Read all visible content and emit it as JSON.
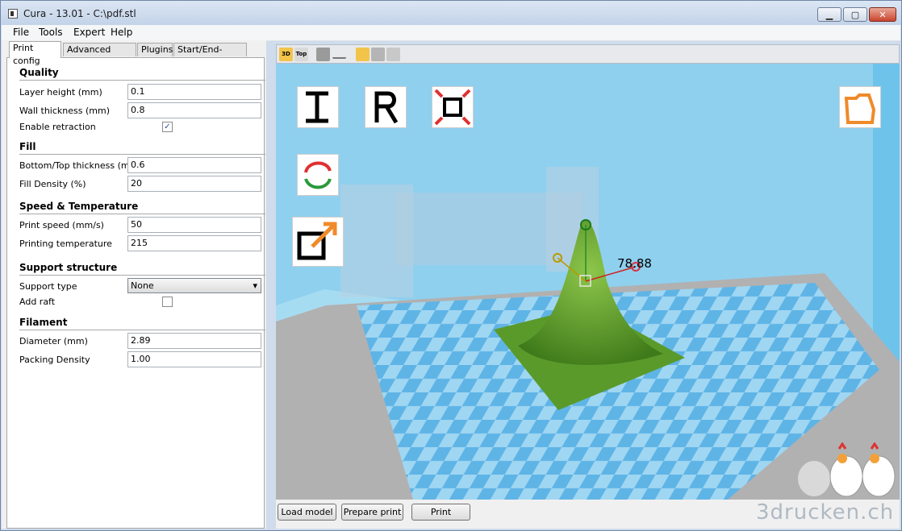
{
  "window": {
    "title": "Cura - 13.01 - C:\\pdf.stl",
    "controls": {
      "minimize": "▁",
      "maximize": "▢",
      "close": "✕"
    }
  },
  "menu": [
    "File",
    "Tools",
    "Expert",
    "Help"
  ],
  "tabs": [
    "Print config",
    "Advanced config",
    "Plugins",
    "Start/End-GCode"
  ],
  "print_config": {
    "quality": {
      "heading": "Quality",
      "layer_height_label": "Layer height (mm)",
      "layer_height": "0.1",
      "wall_thickness_label": "Wall thickness (mm)",
      "wall_thickness": "0.8",
      "enable_retraction_label": "Enable retraction",
      "enable_retraction": true
    },
    "fill": {
      "heading": "Fill",
      "bottom_top_label": "Bottom/Top thickness (mm)",
      "bottom_top": "0.6",
      "density_label": "Fill Density (%)",
      "density": "20"
    },
    "speed": {
      "heading": "Speed & Temperature",
      "print_speed_label": "Print speed (mm/s)",
      "print_speed": "50",
      "temp_label": "Printing temperature",
      "temp": "215"
    },
    "support": {
      "heading": "Support structure",
      "type_label": "Support type",
      "type": "None",
      "raft_label": "Add raft",
      "raft": false
    },
    "filament": {
      "heading": "Filament",
      "diameter_label": "Diameter (mm)",
      "diameter": "2.89",
      "packing_label": "Packing Density",
      "packing": "1.00"
    }
  },
  "view_toolbar": {
    "view_3d": "3D",
    "view_top": "Top"
  },
  "viewport": {
    "scale_readout": "78.88"
  },
  "buttons": {
    "load": "Load model",
    "prepare": "Prepare print",
    "print": "Print"
  },
  "watermark": "3drucken.ch",
  "colors": {
    "model": "#5a9a2a",
    "plate_light": "#9fd6f2",
    "plate_dark": "#5fb4e6",
    "walls": "#8fd0ef"
  }
}
